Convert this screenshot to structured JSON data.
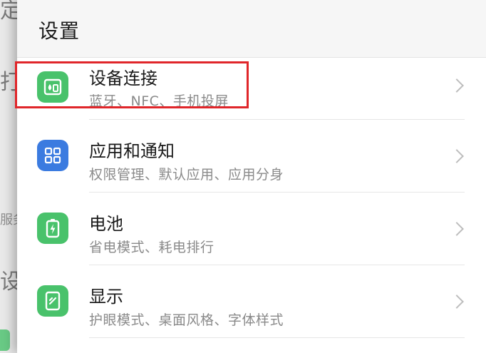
{
  "background": {
    "fragments": [
      "定",
      "打",
      "服务",
      "设置"
    ]
  },
  "header": {
    "title": "设置"
  },
  "settings": {
    "items": [
      {
        "label": "设备连接",
        "sublabel": "蓝牙、NFC、手机投屏",
        "icon": "device-connect-icon",
        "icon_color": "#49c26b",
        "highlighted": true
      },
      {
        "label": "应用和通知",
        "sublabel": "权限管理、默认应用、应用分身",
        "icon": "apps-grid-icon",
        "icon_color": "#3b7be0",
        "highlighted": false
      },
      {
        "label": "电池",
        "sublabel": "省电模式、耗电排行",
        "icon": "battery-icon",
        "icon_color": "#49c26b",
        "highlighted": false
      },
      {
        "label": "显示",
        "sublabel": "护眼模式、桌面风格、字体样式",
        "icon": "display-icon",
        "icon_color": "#49c26b",
        "highlighted": false
      }
    ]
  },
  "colors": {
    "highlight_border": "#e0262a"
  }
}
